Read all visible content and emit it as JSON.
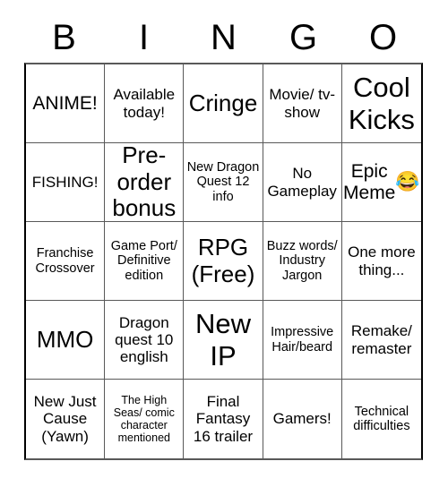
{
  "header": {
    "letters": [
      "B",
      "I",
      "N",
      "G",
      "O"
    ]
  },
  "grid": {
    "rows": 5,
    "columns": 5,
    "border_color": "#595959",
    "background_color": "#ffffff",
    "text_color": "#000000"
  },
  "cells": [
    {
      "text": "ANIME!",
      "size": "fs-l"
    },
    {
      "text": "Available today!",
      "size": "fs-m"
    },
    {
      "text": "Cringe",
      "size": "fs-xl"
    },
    {
      "text": "Movie/ tv-show",
      "size": "fs-m"
    },
    {
      "text": "Cool Kicks",
      "size": "fs-xxl"
    },
    {
      "text": "FISHING!",
      "size": "fs-m"
    },
    {
      "text": "Pre-order bonus",
      "size": "fs-xl"
    },
    {
      "text": "New Dragon Quest 12 info",
      "size": "fs-s"
    },
    {
      "text": "No Gameplay",
      "size": "fs-m"
    },
    {
      "text": "Epic Meme",
      "size": "fs-l",
      "emoji": "😂",
      "emoji_name": "face-with-tears-of-joy-emoji"
    },
    {
      "text": "Franchise Crossover",
      "size": "fs-s"
    },
    {
      "text": "Game Port/ Definitive edition",
      "size": "fs-s"
    },
    {
      "text": "RPG (Free)",
      "size": "fs-xl"
    },
    {
      "text": "Buzz words/ Industry Jargon",
      "size": "fs-s"
    },
    {
      "text": "One more thing...",
      "size": "fs-m"
    },
    {
      "text": "MMO",
      "size": "fs-xl"
    },
    {
      "text": "Dragon quest 10 english",
      "size": "fs-m"
    },
    {
      "text": "New IP",
      "size": "fs-xxl"
    },
    {
      "text": "Impressive Hair/beard",
      "size": "fs-s"
    },
    {
      "text": "Remake/ remaster",
      "size": "fs-m"
    },
    {
      "text": "New Just Cause (Yawn)",
      "size": "fs-m"
    },
    {
      "text": "The High Seas/ comic character mentioned",
      "size": "fs-xs"
    },
    {
      "text": "Final Fantasy 16 trailer",
      "size": "fs-m"
    },
    {
      "text": "Gamers!",
      "size": "fs-m"
    },
    {
      "text": "Technical difficulties",
      "size": "fs-s"
    }
  ]
}
